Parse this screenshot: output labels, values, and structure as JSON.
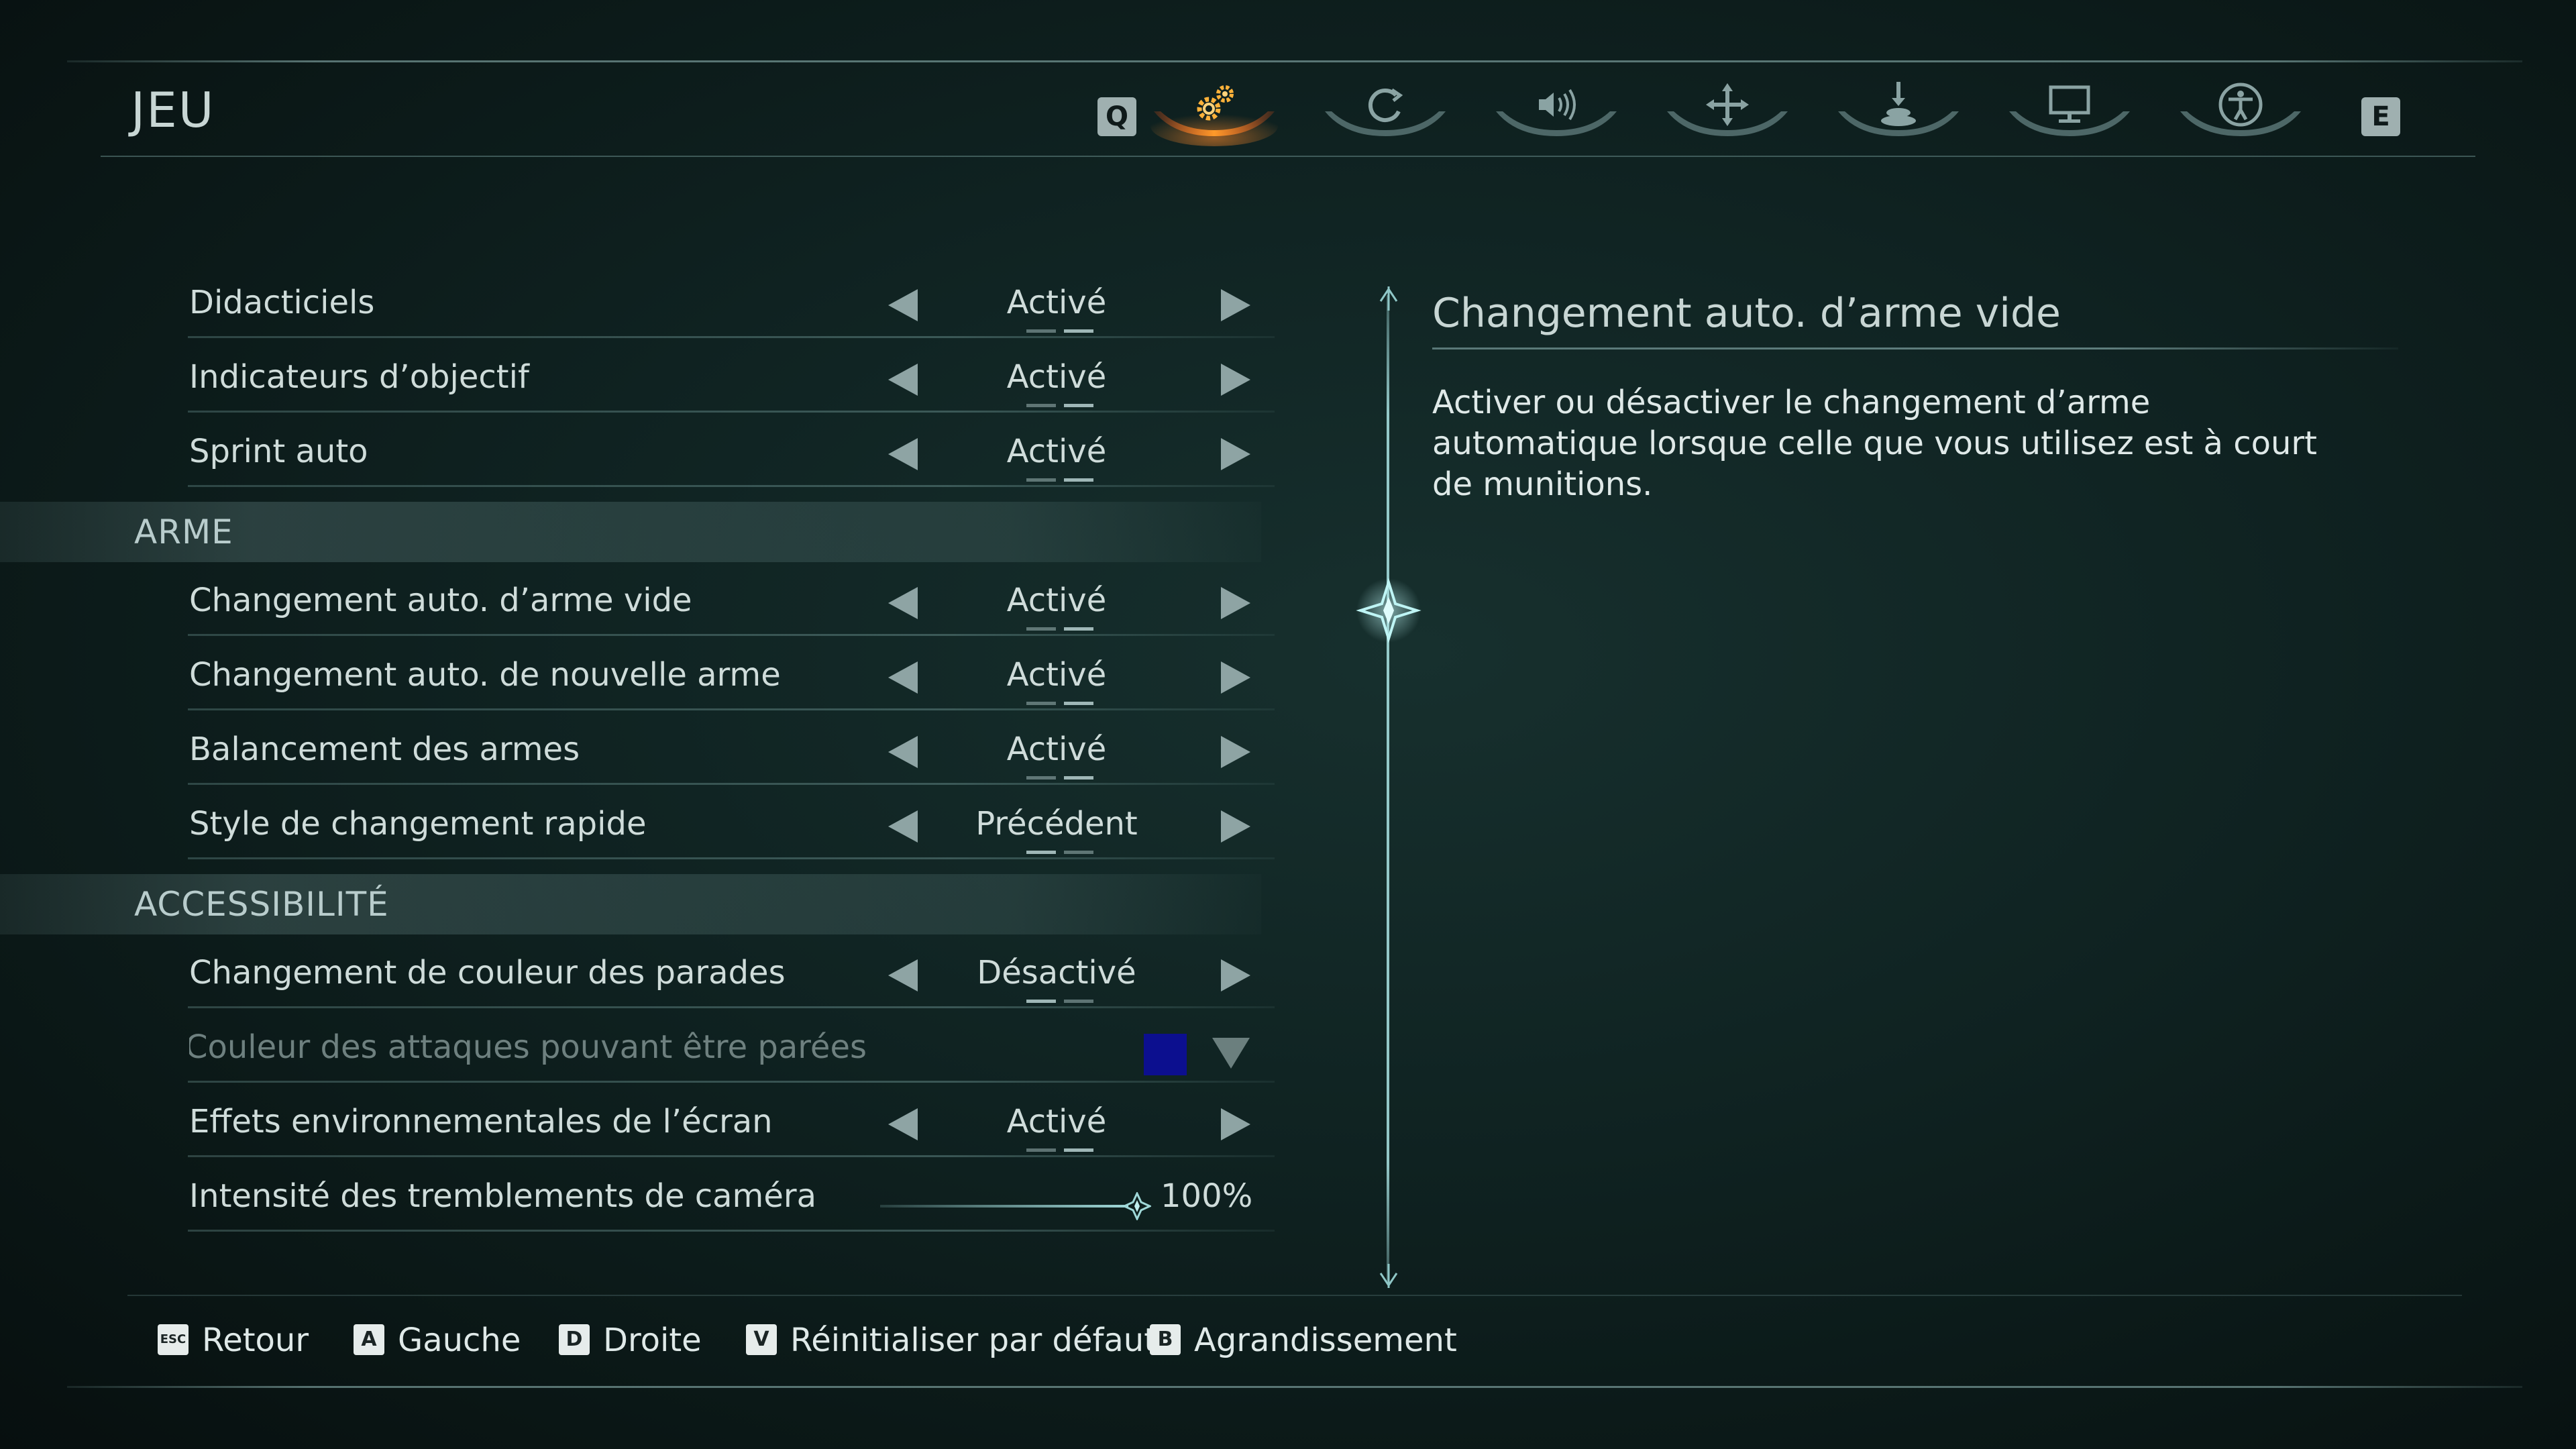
{
  "header": {
    "title": "JEU",
    "prev_key": "Q",
    "next_key": "E",
    "tabs": [
      {
        "icon": "gears-icon",
        "active": true
      },
      {
        "icon": "controller-icon",
        "active": false
      },
      {
        "icon": "audio-icon",
        "active": false
      },
      {
        "icon": "crosshair-icon",
        "active": false
      },
      {
        "icon": "joystick-icon",
        "active": false
      },
      {
        "icon": "monitor-icon",
        "active": false
      },
      {
        "icon": "accessibility-icon",
        "active": false
      }
    ]
  },
  "settings": {
    "general": [
      {
        "label": "Didacticiels",
        "value": "Activé"
      },
      {
        "label": "Indicateurs d’objectif",
        "value": "Activé"
      },
      {
        "label": "Sprint auto",
        "value": "Activé"
      }
    ],
    "weapon_section": "ARME",
    "weapon": [
      {
        "label": "Changement auto. d’arme vide",
        "value": "Activé"
      },
      {
        "label": "Changement auto. de nouvelle arme",
        "value": "Activé"
      },
      {
        "label": "Balancement des armes",
        "value": "Activé"
      },
      {
        "label": "Style de changement rapide",
        "value": "Précédent"
      }
    ],
    "accessibility_section": "ACCESSIBILITÉ",
    "accessibility": [
      {
        "label": "Changement de couleur des parades",
        "value": "Désactivé"
      },
      {
        "label": "Couleur des attaques pouvant être parées",
        "value": "",
        "color": "#0c0f8f"
      },
      {
        "label": "Effets environnementales de l’écran",
        "value": "Activé"
      },
      {
        "label": "Intensité des tremblements de caméra",
        "value": "100%",
        "level": 1.0
      }
    ]
  },
  "description": {
    "title": "Changement auto. d’arme vide",
    "body": "Activer ou désactiver le changement d’arme automatique lorsque celle que vous utilisez est à court de munitions."
  },
  "footer": [
    {
      "key": "ESC",
      "label": "Retour"
    },
    {
      "key": "A",
      "label": "Gauche"
    },
    {
      "key": "D",
      "label": "Droite"
    },
    {
      "key": "V",
      "label": "Réinitialiser par défaut"
    },
    {
      "key": "B",
      "label": "Agrandissement"
    }
  ],
  "colors": {
    "accent": "#e8781c",
    "frame": "#96bebc",
    "text": "#cfdcda"
  }
}
